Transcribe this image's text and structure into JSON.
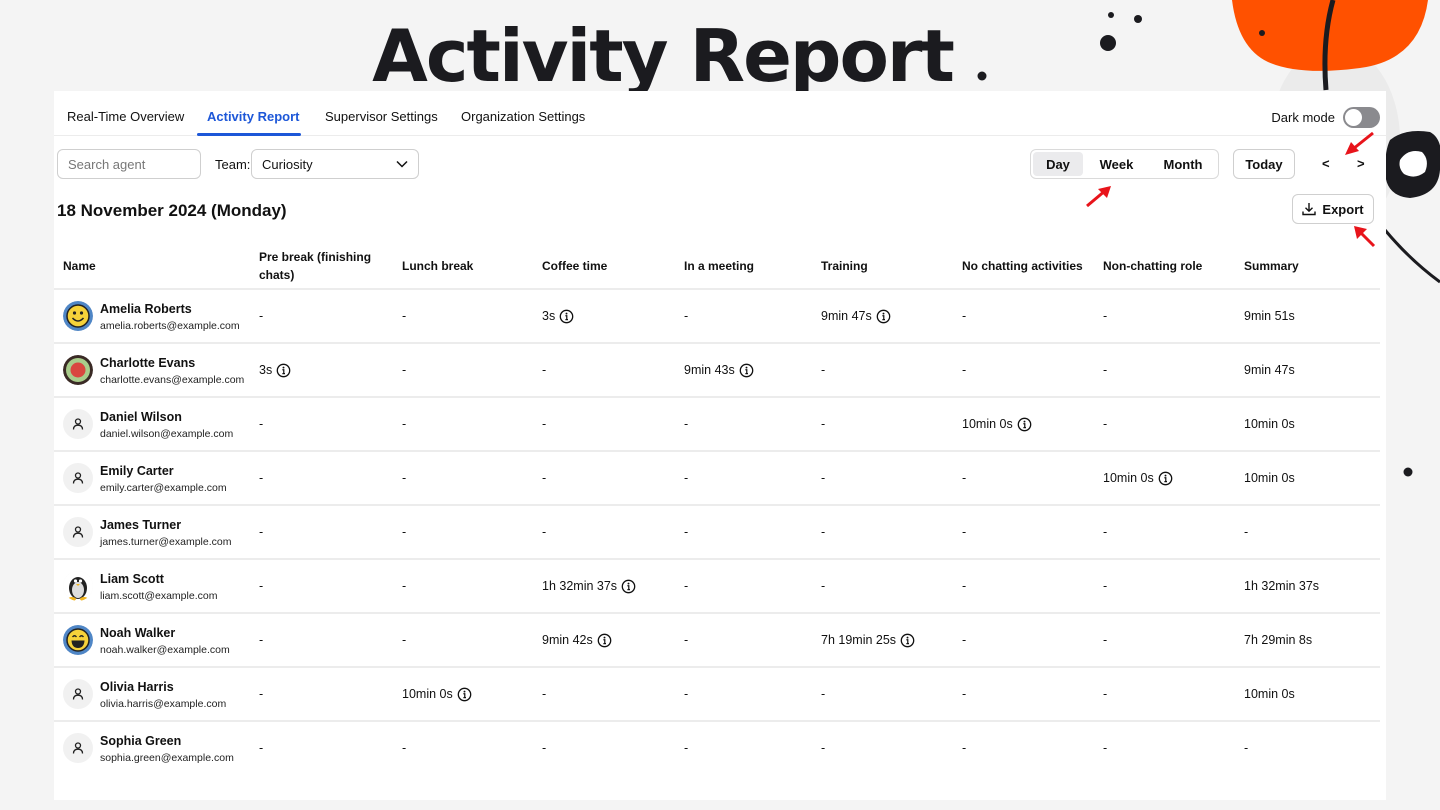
{
  "page_title": "Activity Report",
  "tabs": [
    {
      "label": "Real-Time Overview",
      "active": false
    },
    {
      "label": "Activity Report",
      "active": true
    },
    {
      "label": "Supervisor Settings",
      "active": false
    },
    {
      "label": "Organization Settings",
      "active": false
    }
  ],
  "dark_mode": {
    "label": "Dark mode",
    "enabled": false
  },
  "filters": {
    "search_placeholder": "Search agent",
    "team_label": "Team:",
    "team_value": "Curiosity"
  },
  "period": {
    "options": [
      "Day",
      "Week",
      "Month"
    ],
    "selected": "Day",
    "today_label": "Today",
    "prev_label": "<",
    "next_label": ">"
  },
  "export_label": "Export",
  "date_heading": "18 November 2024 (Monday)",
  "colors": {
    "accent": "#1d57d8",
    "decor_orange": "#ff5100",
    "annotation_red": "#e8141b"
  },
  "table": {
    "columns": [
      "Name",
      "Pre break (finishing chats)",
      "Lunch break",
      "Coffee time",
      "In a meeting",
      "Training",
      "No chatting activities",
      "Non-chatting role",
      "Summary"
    ],
    "rows": [
      {
        "name": "Amelia Roberts",
        "email": "amelia.roberts@example.com",
        "avatar": "smiley-avatar",
        "values": [
          "-",
          "-",
          "3s",
          "-",
          "9min 47s",
          "-",
          "-",
          "9min 51s"
        ],
        "info": [
          false,
          false,
          true,
          false,
          true,
          false,
          false,
          false
        ]
      },
      {
        "name": "Charlotte Evans",
        "email": "charlotte.evans@example.com",
        "avatar": "target-avatar",
        "values": [
          "3s",
          "-",
          "-",
          "9min 43s",
          "-",
          "-",
          "-",
          "9min 47s"
        ],
        "info": [
          true,
          false,
          false,
          true,
          false,
          false,
          false,
          false
        ]
      },
      {
        "name": "Daniel Wilson",
        "email": "daniel.wilson@example.com",
        "avatar": "default-user-avatar",
        "values": [
          "-",
          "-",
          "-",
          "-",
          "-",
          "10min 0s",
          "-",
          "10min 0s"
        ],
        "info": [
          false,
          false,
          false,
          false,
          false,
          true,
          false,
          false
        ]
      },
      {
        "name": "Emily Carter",
        "email": "emily.carter@example.com",
        "avatar": "default-user-avatar",
        "values": [
          "-",
          "-",
          "-",
          "-",
          "-",
          "-",
          "10min 0s",
          "10min 0s"
        ],
        "info": [
          false,
          false,
          false,
          false,
          false,
          false,
          true,
          false
        ]
      },
      {
        "name": "James Turner",
        "email": "james.turner@example.com",
        "avatar": "default-user-avatar",
        "values": [
          "-",
          "-",
          "-",
          "-",
          "-",
          "-",
          "-",
          "-"
        ],
        "info": [
          false,
          false,
          false,
          false,
          false,
          false,
          false,
          false
        ]
      },
      {
        "name": "Liam Scott",
        "email": "liam.scott@example.com",
        "avatar": "penguin-avatar",
        "values": [
          "-",
          "-",
          "1h 32min 37s",
          "-",
          "-",
          "-",
          "-",
          "1h 32min 37s"
        ],
        "info": [
          false,
          false,
          true,
          false,
          false,
          false,
          false,
          false
        ]
      },
      {
        "name": "Noah Walker",
        "email": "noah.walker@example.com",
        "avatar": "laughing-avatar",
        "values": [
          "-",
          "-",
          "9min 42s",
          "-",
          "7h 19min 25s",
          "-",
          "-",
          "7h 29min 8s"
        ],
        "info": [
          false,
          false,
          true,
          false,
          true,
          false,
          false,
          false
        ]
      },
      {
        "name": "Olivia Harris",
        "email": "olivia.harris@example.com",
        "avatar": "default-user-avatar",
        "values": [
          "-",
          "10min 0s",
          "-",
          "-",
          "-",
          "-",
          "-",
          "10min 0s"
        ],
        "info": [
          false,
          true,
          false,
          false,
          false,
          false,
          false,
          false
        ]
      },
      {
        "name": "Sophia Green",
        "email": "sophia.green@example.com",
        "avatar": "default-user-avatar",
        "values": [
          "-",
          "-",
          "-",
          "-",
          "-",
          "-",
          "-",
          "-"
        ],
        "info": [
          false,
          false,
          false,
          false,
          false,
          false,
          false,
          false
        ]
      }
    ]
  }
}
